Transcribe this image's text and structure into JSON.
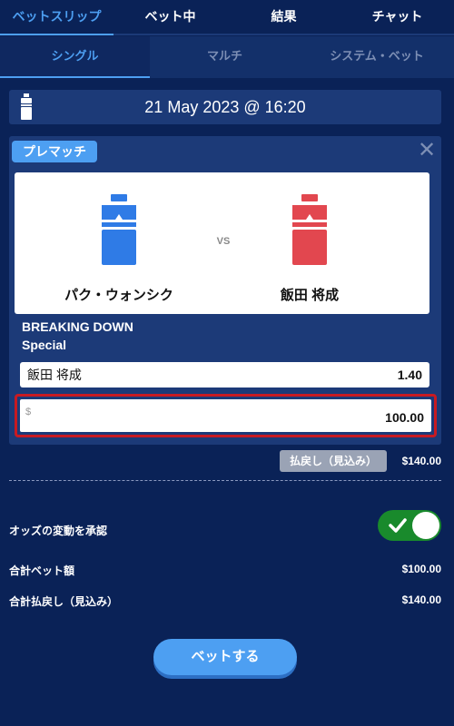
{
  "top_tabs": [
    {
      "label": "ベットスリップ"
    },
    {
      "label": "ベット中"
    },
    {
      "label": "結果"
    },
    {
      "label": "チャット"
    }
  ],
  "sub_tabs": [
    {
      "label": "シングル"
    },
    {
      "label": "マルチ"
    },
    {
      "label": "システム・ベット"
    }
  ],
  "event_date": "21 May 2023 @ 16:20",
  "bet": {
    "badge": "プレマッチ",
    "close_symbol": "✕",
    "fighter1": "パク・ウォンシク",
    "fighter2": "飯田 将成",
    "vs": "VS",
    "competition": "BREAKING DOWN",
    "market": "Special",
    "selection": "飯田 将成",
    "odds": "1.40",
    "stake_currency": "$",
    "stake_amount": "100.00",
    "payout_label": "払戻し（見込み）",
    "payout_value": "$140.00"
  },
  "summary": {
    "accept_odds_label": "オッズの変動を承認",
    "accept_odds_on": true,
    "total_stake_label": "合計ベット額",
    "total_stake_value": "$100.00",
    "total_payout_label": "合計払戻し（見込み）",
    "total_payout_value": "$140.00"
  },
  "place_bet_label": "ベットする",
  "colors": {
    "background": "#0a2257",
    "accent": "#4d9ff2",
    "fighter1": "#2f7be6",
    "fighter2": "#e2474f",
    "toggle_on": "#198a2c",
    "highlight": "#c81a22"
  },
  "icons": {
    "sport": "punching-bag-icon",
    "close": "close-icon",
    "toggle": "check-icon"
  }
}
